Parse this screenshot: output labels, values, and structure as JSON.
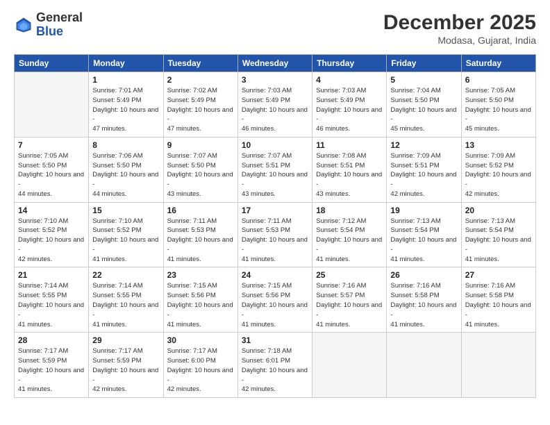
{
  "header": {
    "logo_general": "General",
    "logo_blue": "Blue",
    "month_title": "December 2025",
    "location": "Modasa, Gujarat, India"
  },
  "weekdays": [
    "Sunday",
    "Monday",
    "Tuesday",
    "Wednesday",
    "Thursday",
    "Friday",
    "Saturday"
  ],
  "weeks": [
    [
      {
        "day": "",
        "sunrise": "",
        "sunset": "",
        "daylight": "",
        "empty": true
      },
      {
        "day": "1",
        "sunrise": "Sunrise: 7:01 AM",
        "sunset": "Sunset: 5:49 PM",
        "daylight": "Daylight: 10 hours and 47 minutes.",
        "empty": false
      },
      {
        "day": "2",
        "sunrise": "Sunrise: 7:02 AM",
        "sunset": "Sunset: 5:49 PM",
        "daylight": "Daylight: 10 hours and 47 minutes.",
        "empty": false
      },
      {
        "day": "3",
        "sunrise": "Sunrise: 7:03 AM",
        "sunset": "Sunset: 5:49 PM",
        "daylight": "Daylight: 10 hours and 46 minutes.",
        "empty": false
      },
      {
        "day": "4",
        "sunrise": "Sunrise: 7:03 AM",
        "sunset": "Sunset: 5:49 PM",
        "daylight": "Daylight: 10 hours and 46 minutes.",
        "empty": false
      },
      {
        "day": "5",
        "sunrise": "Sunrise: 7:04 AM",
        "sunset": "Sunset: 5:50 PM",
        "daylight": "Daylight: 10 hours and 45 minutes.",
        "empty": false
      },
      {
        "day": "6",
        "sunrise": "Sunrise: 7:05 AM",
        "sunset": "Sunset: 5:50 PM",
        "daylight": "Daylight: 10 hours and 45 minutes.",
        "empty": false
      }
    ],
    [
      {
        "day": "7",
        "sunrise": "Sunrise: 7:05 AM",
        "sunset": "Sunset: 5:50 PM",
        "daylight": "Daylight: 10 hours and 44 minutes.",
        "empty": false
      },
      {
        "day": "8",
        "sunrise": "Sunrise: 7:06 AM",
        "sunset": "Sunset: 5:50 PM",
        "daylight": "Daylight: 10 hours and 44 minutes.",
        "empty": false
      },
      {
        "day": "9",
        "sunrise": "Sunrise: 7:07 AM",
        "sunset": "Sunset: 5:50 PM",
        "daylight": "Daylight: 10 hours and 43 minutes.",
        "empty": false
      },
      {
        "day": "10",
        "sunrise": "Sunrise: 7:07 AM",
        "sunset": "Sunset: 5:51 PM",
        "daylight": "Daylight: 10 hours and 43 minutes.",
        "empty": false
      },
      {
        "day": "11",
        "sunrise": "Sunrise: 7:08 AM",
        "sunset": "Sunset: 5:51 PM",
        "daylight": "Daylight: 10 hours and 43 minutes.",
        "empty": false
      },
      {
        "day": "12",
        "sunrise": "Sunrise: 7:09 AM",
        "sunset": "Sunset: 5:51 PM",
        "daylight": "Daylight: 10 hours and 42 minutes.",
        "empty": false
      },
      {
        "day": "13",
        "sunrise": "Sunrise: 7:09 AM",
        "sunset": "Sunset: 5:52 PM",
        "daylight": "Daylight: 10 hours and 42 minutes.",
        "empty": false
      }
    ],
    [
      {
        "day": "14",
        "sunrise": "Sunrise: 7:10 AM",
        "sunset": "Sunset: 5:52 PM",
        "daylight": "Daylight: 10 hours and 42 minutes.",
        "empty": false
      },
      {
        "day": "15",
        "sunrise": "Sunrise: 7:10 AM",
        "sunset": "Sunset: 5:52 PM",
        "daylight": "Daylight: 10 hours and 41 minutes.",
        "empty": false
      },
      {
        "day": "16",
        "sunrise": "Sunrise: 7:11 AM",
        "sunset": "Sunset: 5:53 PM",
        "daylight": "Daylight: 10 hours and 41 minutes.",
        "empty": false
      },
      {
        "day": "17",
        "sunrise": "Sunrise: 7:11 AM",
        "sunset": "Sunset: 5:53 PM",
        "daylight": "Daylight: 10 hours and 41 minutes.",
        "empty": false
      },
      {
        "day": "18",
        "sunrise": "Sunrise: 7:12 AM",
        "sunset": "Sunset: 5:54 PM",
        "daylight": "Daylight: 10 hours and 41 minutes.",
        "empty": false
      },
      {
        "day": "19",
        "sunrise": "Sunrise: 7:13 AM",
        "sunset": "Sunset: 5:54 PM",
        "daylight": "Daylight: 10 hours and 41 minutes.",
        "empty": false
      },
      {
        "day": "20",
        "sunrise": "Sunrise: 7:13 AM",
        "sunset": "Sunset: 5:54 PM",
        "daylight": "Daylight: 10 hours and 41 minutes.",
        "empty": false
      }
    ],
    [
      {
        "day": "21",
        "sunrise": "Sunrise: 7:14 AM",
        "sunset": "Sunset: 5:55 PM",
        "daylight": "Daylight: 10 hours and 41 minutes.",
        "empty": false
      },
      {
        "day": "22",
        "sunrise": "Sunrise: 7:14 AM",
        "sunset": "Sunset: 5:55 PM",
        "daylight": "Daylight: 10 hours and 41 minutes.",
        "empty": false
      },
      {
        "day": "23",
        "sunrise": "Sunrise: 7:15 AM",
        "sunset": "Sunset: 5:56 PM",
        "daylight": "Daylight: 10 hours and 41 minutes.",
        "empty": false
      },
      {
        "day": "24",
        "sunrise": "Sunrise: 7:15 AM",
        "sunset": "Sunset: 5:56 PM",
        "daylight": "Daylight: 10 hours and 41 minutes.",
        "empty": false
      },
      {
        "day": "25",
        "sunrise": "Sunrise: 7:16 AM",
        "sunset": "Sunset: 5:57 PM",
        "daylight": "Daylight: 10 hours and 41 minutes.",
        "empty": false
      },
      {
        "day": "26",
        "sunrise": "Sunrise: 7:16 AM",
        "sunset": "Sunset: 5:58 PM",
        "daylight": "Daylight: 10 hours and 41 minutes.",
        "empty": false
      },
      {
        "day": "27",
        "sunrise": "Sunrise: 7:16 AM",
        "sunset": "Sunset: 5:58 PM",
        "daylight": "Daylight: 10 hours and 41 minutes.",
        "empty": false
      }
    ],
    [
      {
        "day": "28",
        "sunrise": "Sunrise: 7:17 AM",
        "sunset": "Sunset: 5:59 PM",
        "daylight": "Daylight: 10 hours and 41 minutes.",
        "empty": false
      },
      {
        "day": "29",
        "sunrise": "Sunrise: 7:17 AM",
        "sunset": "Sunset: 5:59 PM",
        "daylight": "Daylight: 10 hours and 42 minutes.",
        "empty": false
      },
      {
        "day": "30",
        "sunrise": "Sunrise: 7:17 AM",
        "sunset": "Sunset: 6:00 PM",
        "daylight": "Daylight: 10 hours and 42 minutes.",
        "empty": false
      },
      {
        "day": "31",
        "sunrise": "Sunrise: 7:18 AM",
        "sunset": "Sunset: 6:01 PM",
        "daylight": "Daylight: 10 hours and 42 minutes.",
        "empty": false
      },
      {
        "day": "",
        "sunrise": "",
        "sunset": "",
        "daylight": "",
        "empty": true
      },
      {
        "day": "",
        "sunrise": "",
        "sunset": "",
        "daylight": "",
        "empty": true
      },
      {
        "day": "",
        "sunrise": "",
        "sunset": "",
        "daylight": "",
        "empty": true
      }
    ]
  ]
}
